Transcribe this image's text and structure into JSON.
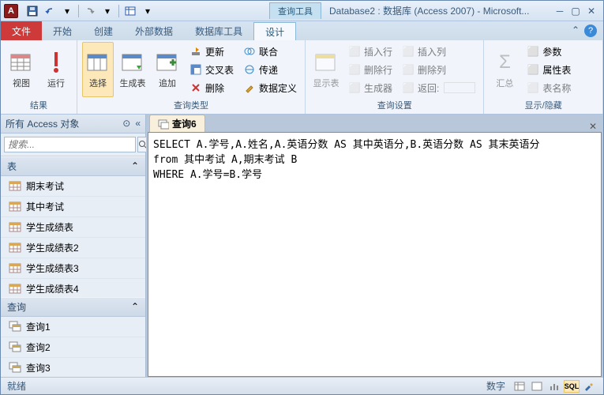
{
  "titlebar": {
    "app_letter": "A",
    "context_tab": "查询工具",
    "title": "Database2 : 数据库 (Access 2007) - Microsoft..."
  },
  "tabs": {
    "file": "文件",
    "items": [
      "开始",
      "创建",
      "外部数据",
      "数据库工具",
      "设计"
    ],
    "active": "设计"
  },
  "ribbon": {
    "groups": {
      "results": {
        "label": "结果",
        "view": "视图",
        "run": "运行"
      },
      "querytype": {
        "label": "查询类型",
        "select": "选择",
        "maketable": "生成表",
        "append": "追加",
        "update": "更新",
        "crosstab": "交叉表",
        "delete": "删除",
        "union": "联合",
        "passthrough": "传递",
        "datadef": "数据定义"
      },
      "setup": {
        "label": "查询设置",
        "showtable": "显示表",
        "insertrows": "插入行",
        "deleterows": "删除行",
        "builder": "生成器",
        "insertcols": "插入列",
        "deletecols": "删除列",
        "return": "返回:"
      },
      "showhide": {
        "label": "显示/隐藏",
        "totals": "汇总",
        "params": "参数",
        "propsheet": "属性表",
        "tablenames": "表名称"
      }
    }
  },
  "navpane": {
    "title": "所有 Access 对象",
    "search_placeholder": "搜索...",
    "sections": {
      "tables": {
        "label": "表",
        "items": [
          "期末考试",
          "其中考试",
          "学生成绩表",
          "学生成绩表2",
          "学生成绩表3",
          "学生成绩表4"
        ]
      },
      "queries": {
        "label": "查询",
        "items": [
          "查询1",
          "查询2",
          "查询3"
        ]
      }
    }
  },
  "doc": {
    "tab_label": "查询6",
    "sql": "SELECT A.学号,A.姓名,A.英语分数 AS 其中英语分,B.英语分数 AS 其末英语分\nfrom 其中考试 A,期末考试 B\nWHERE A.学号=B.学号"
  },
  "statusbar": {
    "ready": "就绪",
    "mode": "数字",
    "sql_label": "SQL"
  }
}
